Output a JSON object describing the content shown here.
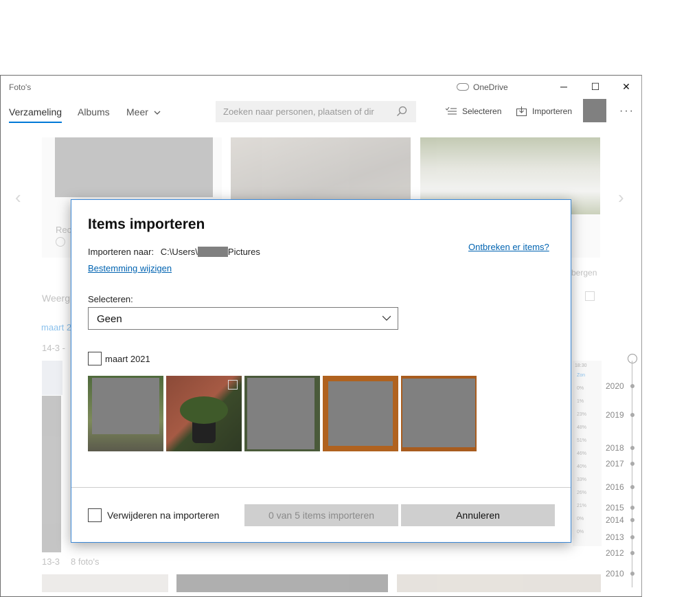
{
  "window": {
    "app_title": "Foto's",
    "onedrive_label": "OneDrive",
    "minimize": "─",
    "maximize": "☐",
    "close": "✕"
  },
  "nav": {
    "tabs": [
      {
        "label": "Verzameling"
      },
      {
        "label": "Albums"
      },
      {
        "label": "Meer"
      }
    ],
    "search_placeholder": "Zoeken naar personen, plaatsen of dir",
    "select_label": "Selecteren",
    "import_label": "Importeren",
    "more": "···"
  },
  "background": {
    "card_text_1": "Rec",
    "weergave_fragment": "Weerg",
    "maart_fragment": "maart 2",
    "date_1": "14-3 -",
    "verbergen_fragment": "bergen",
    "date_2": "13-3",
    "date_2_count": "8 foto's",
    "phone_time": "18:30",
    "phone_header": "Zon",
    "percentages": [
      "0%",
      "1%",
      "23%",
      "48%",
      "51%",
      "46%",
      "40%",
      "33%",
      "26%",
      "21%",
      "0%",
      "0%"
    ],
    "timeline_years": [
      "2020",
      "2019",
      "2018",
      "2017",
      "2016",
      "2015",
      "2014",
      "2013",
      "2012",
      "2010"
    ]
  },
  "dialog": {
    "title": "Items importeren",
    "import_to_label": "Importeren naar:",
    "path_prefix": "C:\\Users\\",
    "path_suffix": "Pictures",
    "missing_items_link": "Ontbreken er items?",
    "change_destination_link": "Bestemming wijzigen",
    "select_label": "Selecteren:",
    "select_value": "Geen",
    "group_label": "maart 2021",
    "delete_after_import_label": "Verwijderen na importeren",
    "import_button_label": "0 van 5 items importeren",
    "cancel_button_label": "Annuleren"
  }
}
